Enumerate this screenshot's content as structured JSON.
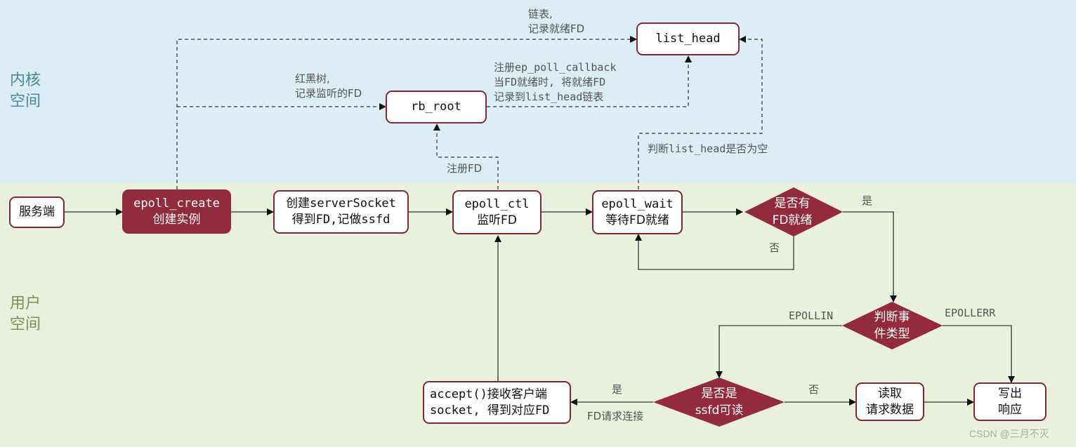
{
  "zones": {
    "kernel": {
      "label_line1": "内核",
      "label_line2": "空间",
      "color": "#daedf3"
    },
    "user": {
      "label_line1": "用户",
      "label_line2": "空间",
      "color": "#e9f0de"
    }
  },
  "colors": {
    "accent": "#922b3b",
    "border": "#7d2a36",
    "line": "#333333"
  },
  "nodes": {
    "server": {
      "line1": "服务端"
    },
    "epoll_create": {
      "line1": "epoll_create",
      "line2": "创建实例"
    },
    "create_socket": {
      "line1": "创建serverSocket",
      "line2": "得到FD,记做ssfd"
    },
    "epoll_ctl": {
      "line1": "epoll_ctl",
      "line2": "监听FD"
    },
    "epoll_wait": {
      "line1": "epoll_wait",
      "line2": "等待FD就绪"
    },
    "rb_root": {
      "line1": "rb_root"
    },
    "list_head": {
      "line1": "list_head"
    },
    "accept": {
      "line1": "accept()接收客户端",
      "line2": "socket, 得到对应FD"
    },
    "read_data": {
      "line1": "读取",
      "line2": "请求数据"
    },
    "write_resp": {
      "line1": "写出",
      "line2": "响应"
    }
  },
  "decisions": {
    "fd_ready": {
      "line1": "是否有",
      "line2": "FD就绪"
    },
    "event_type": {
      "line1": "判断事",
      "line2": "件类型"
    },
    "is_ssfd": {
      "line1": "是否是",
      "line2": "ssfd可读"
    }
  },
  "notes": {
    "list_note_1": "链表,",
    "list_note_2": "记录就绪FD",
    "rb_note_1": "红黑树,",
    "rb_note_2": "记录监听的FD",
    "cb_note_1": "注册ep_poll_callback",
    "cb_note_2": "当FD就绪时, 将就绪FD",
    "cb_note_3": "记录到list_head链表",
    "reg_fd": "注册FD",
    "check_list": "判断list_head是否为空",
    "yes_ready": "是",
    "no_ready": "否",
    "epollin": "EPOLLIN",
    "epollerr": "EPOLLERR",
    "yes_ssfd": "是",
    "fd_conn": "FD请求连接",
    "no_ssfd": "否"
  },
  "watermark": "CSDN @三月不灭"
}
